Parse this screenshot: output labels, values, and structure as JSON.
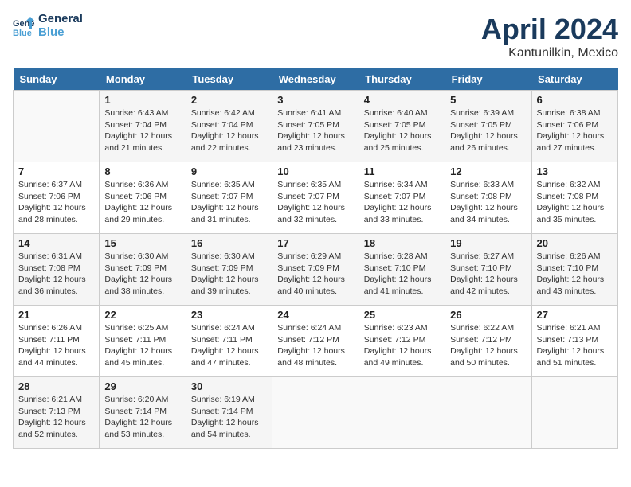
{
  "header": {
    "logo_line1": "General",
    "logo_line2": "Blue",
    "month": "April 2024",
    "location": "Kantunilkin, Mexico"
  },
  "days_of_week": [
    "Sunday",
    "Monday",
    "Tuesday",
    "Wednesday",
    "Thursday",
    "Friday",
    "Saturday"
  ],
  "weeks": [
    [
      {
        "day": "",
        "info": ""
      },
      {
        "day": "1",
        "info": "Sunrise: 6:43 AM\nSunset: 7:04 PM\nDaylight: 12 hours\nand 21 minutes."
      },
      {
        "day": "2",
        "info": "Sunrise: 6:42 AM\nSunset: 7:04 PM\nDaylight: 12 hours\nand 22 minutes."
      },
      {
        "day": "3",
        "info": "Sunrise: 6:41 AM\nSunset: 7:05 PM\nDaylight: 12 hours\nand 23 minutes."
      },
      {
        "day": "4",
        "info": "Sunrise: 6:40 AM\nSunset: 7:05 PM\nDaylight: 12 hours\nand 25 minutes."
      },
      {
        "day": "5",
        "info": "Sunrise: 6:39 AM\nSunset: 7:05 PM\nDaylight: 12 hours\nand 26 minutes."
      },
      {
        "day": "6",
        "info": "Sunrise: 6:38 AM\nSunset: 7:06 PM\nDaylight: 12 hours\nand 27 minutes."
      }
    ],
    [
      {
        "day": "7",
        "info": "Sunrise: 6:37 AM\nSunset: 7:06 PM\nDaylight: 12 hours\nand 28 minutes."
      },
      {
        "day": "8",
        "info": "Sunrise: 6:36 AM\nSunset: 7:06 PM\nDaylight: 12 hours\nand 29 minutes."
      },
      {
        "day": "9",
        "info": "Sunrise: 6:35 AM\nSunset: 7:07 PM\nDaylight: 12 hours\nand 31 minutes."
      },
      {
        "day": "10",
        "info": "Sunrise: 6:35 AM\nSunset: 7:07 PM\nDaylight: 12 hours\nand 32 minutes."
      },
      {
        "day": "11",
        "info": "Sunrise: 6:34 AM\nSunset: 7:07 PM\nDaylight: 12 hours\nand 33 minutes."
      },
      {
        "day": "12",
        "info": "Sunrise: 6:33 AM\nSunset: 7:08 PM\nDaylight: 12 hours\nand 34 minutes."
      },
      {
        "day": "13",
        "info": "Sunrise: 6:32 AM\nSunset: 7:08 PM\nDaylight: 12 hours\nand 35 minutes."
      }
    ],
    [
      {
        "day": "14",
        "info": "Sunrise: 6:31 AM\nSunset: 7:08 PM\nDaylight: 12 hours\nand 36 minutes."
      },
      {
        "day": "15",
        "info": "Sunrise: 6:30 AM\nSunset: 7:09 PM\nDaylight: 12 hours\nand 38 minutes."
      },
      {
        "day": "16",
        "info": "Sunrise: 6:30 AM\nSunset: 7:09 PM\nDaylight: 12 hours\nand 39 minutes."
      },
      {
        "day": "17",
        "info": "Sunrise: 6:29 AM\nSunset: 7:09 PM\nDaylight: 12 hours\nand 40 minutes."
      },
      {
        "day": "18",
        "info": "Sunrise: 6:28 AM\nSunset: 7:10 PM\nDaylight: 12 hours\nand 41 minutes."
      },
      {
        "day": "19",
        "info": "Sunrise: 6:27 AM\nSunset: 7:10 PM\nDaylight: 12 hours\nand 42 minutes."
      },
      {
        "day": "20",
        "info": "Sunrise: 6:26 AM\nSunset: 7:10 PM\nDaylight: 12 hours\nand 43 minutes."
      }
    ],
    [
      {
        "day": "21",
        "info": "Sunrise: 6:26 AM\nSunset: 7:11 PM\nDaylight: 12 hours\nand 44 minutes."
      },
      {
        "day": "22",
        "info": "Sunrise: 6:25 AM\nSunset: 7:11 PM\nDaylight: 12 hours\nand 45 minutes."
      },
      {
        "day": "23",
        "info": "Sunrise: 6:24 AM\nSunset: 7:11 PM\nDaylight: 12 hours\nand 47 minutes."
      },
      {
        "day": "24",
        "info": "Sunrise: 6:24 AM\nSunset: 7:12 PM\nDaylight: 12 hours\nand 48 minutes."
      },
      {
        "day": "25",
        "info": "Sunrise: 6:23 AM\nSunset: 7:12 PM\nDaylight: 12 hours\nand 49 minutes."
      },
      {
        "day": "26",
        "info": "Sunrise: 6:22 AM\nSunset: 7:12 PM\nDaylight: 12 hours\nand 50 minutes."
      },
      {
        "day": "27",
        "info": "Sunrise: 6:21 AM\nSunset: 7:13 PM\nDaylight: 12 hours\nand 51 minutes."
      }
    ],
    [
      {
        "day": "28",
        "info": "Sunrise: 6:21 AM\nSunset: 7:13 PM\nDaylight: 12 hours\nand 52 minutes."
      },
      {
        "day": "29",
        "info": "Sunrise: 6:20 AM\nSunset: 7:14 PM\nDaylight: 12 hours\nand 53 minutes."
      },
      {
        "day": "30",
        "info": "Sunrise: 6:19 AM\nSunset: 7:14 PM\nDaylight: 12 hours\nand 54 minutes."
      },
      {
        "day": "",
        "info": ""
      },
      {
        "day": "",
        "info": ""
      },
      {
        "day": "",
        "info": ""
      },
      {
        "day": "",
        "info": ""
      }
    ]
  ]
}
